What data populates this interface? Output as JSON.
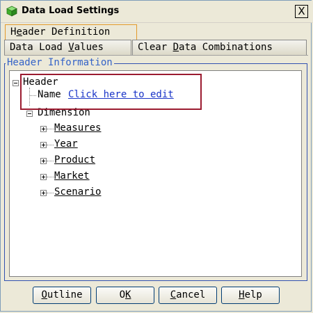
{
  "window": {
    "title": "Data Load Settings",
    "close_label": "X"
  },
  "tabs": {
    "header_definition": {
      "pre": "H",
      "key": "e",
      "post": "ader Definition"
    },
    "data_load_values": {
      "pre": "Data Load ",
      "key": "V",
      "post": "alues"
    },
    "clear_data_combinations": {
      "pre": "Clear ",
      "key": "D",
      "post": "ata Combinations"
    }
  },
  "group": {
    "title": "Header Information"
  },
  "tree": {
    "root": "Header",
    "name_label": "Name",
    "name_value": "Click here to edit",
    "dimension_label": "Dimension",
    "dimensions": [
      "Measures",
      "Year",
      "Product",
      "Market",
      "Scenario"
    ]
  },
  "buttons": {
    "outline": {
      "key": "O",
      "post": "utline"
    },
    "ok": {
      "pre": "O",
      "key": "K",
      "post": ""
    },
    "cancel": {
      "key": "C",
      "post": "ancel"
    },
    "help": {
      "key": "H",
      "post": "elp"
    }
  },
  "colors": {
    "highlight_border": "#9b1b30",
    "link_blue": "#1a35c8",
    "group_title": "#3463c8",
    "active_tab_border": "#e39a2a"
  }
}
